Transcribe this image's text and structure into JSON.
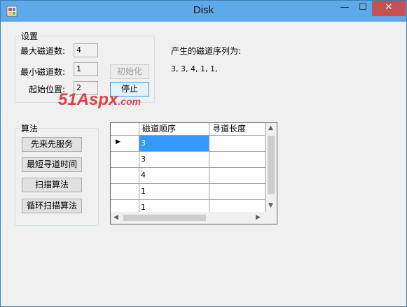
{
  "window": {
    "title": "Disk"
  },
  "titlebar": {
    "minimize": "—",
    "maximize": "☐",
    "close": "✕"
  },
  "settings": {
    "legend": "设置",
    "max_label": "最大磁道数:",
    "max_value": "4",
    "min_label": "最小磁道数:",
    "min_value": "1",
    "start_label": "起始位置:",
    "start_value": "2",
    "init_button": "初始化",
    "stop_button": "停止"
  },
  "sequence": {
    "label": "产生的磁道序列为:",
    "value": "3, 3, 4, 1, 1,"
  },
  "algorithm": {
    "legend": "算法",
    "fcfs": "先来先服务",
    "sstf": "最短寻道时间",
    "scan": "扫描算法",
    "cscan": "循环扫描算法"
  },
  "grid": {
    "headers": [
      "磁道顺序",
      "寻道长度"
    ],
    "rows": [
      "3",
      "3",
      "4",
      "1",
      "1"
    ],
    "current_row_marker": "▶"
  },
  "watermark": {
    "brand": "51Aspx",
    "domain": ".com"
  },
  "colors": {
    "titlebar": "#5ea9e9",
    "close": "#c75050",
    "selection": "#3399ff",
    "watermark": "#d9252a"
  }
}
